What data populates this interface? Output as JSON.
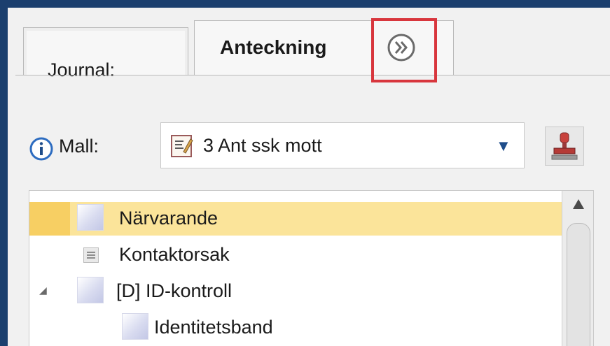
{
  "tabs": [
    {
      "label": "Journal:",
      "active": false
    },
    {
      "label": "Anteckning",
      "active": true
    }
  ],
  "expand_icon": "double-chevron-right-icon",
  "mall": {
    "label": "Mall:",
    "value": "3 Ant ssk mott",
    "info_icon": "info-icon",
    "template_icon": "document-edit-icon",
    "dropdown_icon": "triangle-down-icon",
    "stamp_icon": "stamp-icon"
  },
  "tree": {
    "items": [
      {
        "label": "Närvarande",
        "selected": true,
        "icon": "node-icon",
        "level": 1
      },
      {
        "label": "Kontaktorsak",
        "selected": false,
        "icon": "text-lines-icon",
        "level": 1
      },
      {
        "label": "[D] ID-kontroll",
        "selected": false,
        "icon": "node-icon",
        "level": 1,
        "expanded": true
      },
      {
        "label": "Identitetsband",
        "selected": false,
        "icon": "node-icon",
        "level": 2
      }
    ]
  },
  "colors": {
    "frame": "#1b3f6e",
    "highlight": "#d8363d",
    "selection": "#fbe49a",
    "accent": "#1f4d8a"
  }
}
